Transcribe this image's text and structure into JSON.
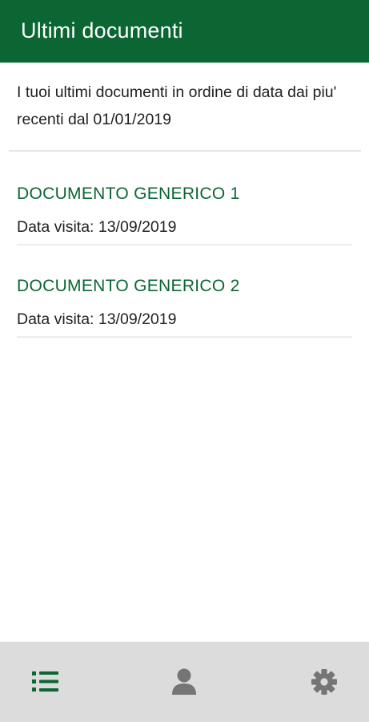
{
  "header": {
    "title": "Ultimi documenti"
  },
  "intro": {
    "text": "I tuoi ultimi documenti in ordine di data dai piu' recenti dal 01/01/2019"
  },
  "documents": [
    {
      "title": "DOCUMENTO GENERICO 1",
      "date": "Data visita: 13/09/2019"
    },
    {
      "title": "DOCUMENTO GENERICO 2",
      "date": "Data visita: 13/09/2019"
    }
  ],
  "bottom_nav": {
    "items": [
      {
        "icon": "list-icon",
        "active": true
      },
      {
        "icon": "person-icon",
        "active": false
      },
      {
        "icon": "gear-icon",
        "active": false
      }
    ]
  },
  "colors": {
    "primary": "#0b6634",
    "nav_background": "#dcdcdc",
    "nav_inactive": "#757575"
  }
}
